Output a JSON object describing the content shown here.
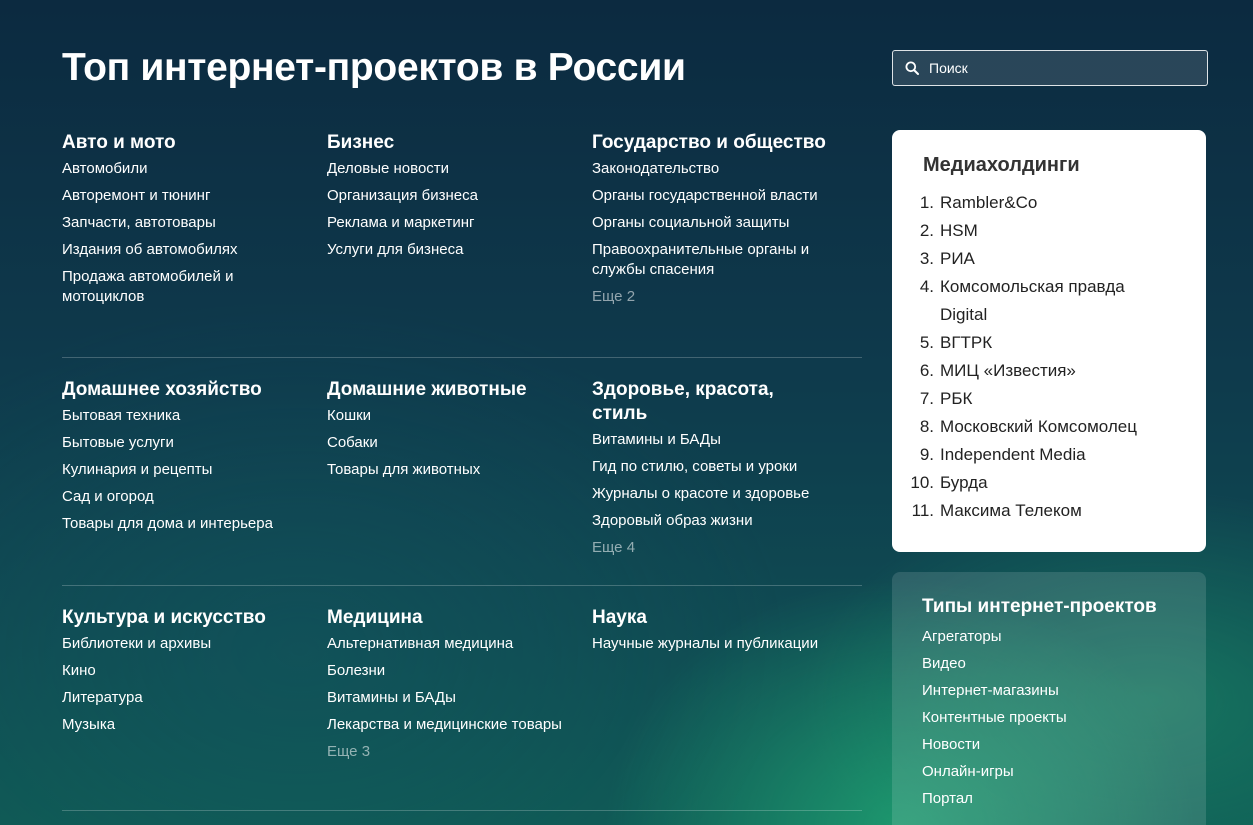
{
  "page_title": "Топ интернет-проектов в России",
  "search": {
    "placeholder": "Поиск"
  },
  "categories": [
    {
      "title": "Авто и мото",
      "links": [
        "Автомобили",
        "Авторемонт и тюнинг",
        "Запчасти, автотовары",
        "Издания об автомобилях",
        "Продажа автомобилей и мотоциклов"
      ],
      "more": ""
    },
    {
      "title": "Бизнес",
      "links": [
        "Деловые новости",
        "Организация бизнеса",
        "Реклама и маркетинг",
        "Услуги для бизнеса"
      ],
      "more": ""
    },
    {
      "title": "Государство и общество",
      "links": [
        "Законодательство",
        "Органы государственной власти",
        "Органы социальной защиты",
        "Правоохранительные органы и службы спасения"
      ],
      "more": "Еще 2"
    },
    {
      "title": "Домашнее хозяйство",
      "links": [
        "Бытовая техника",
        "Бытовые услуги",
        "Кулинария и рецепты",
        "Сад и огород",
        "Товары для дома и интерьера"
      ],
      "more": ""
    },
    {
      "title": "Домашние животные",
      "links": [
        "Кошки",
        "Собаки",
        "Товары для животных"
      ],
      "more": ""
    },
    {
      "title": "Здоровье, красота, стиль",
      "links": [
        "Витамины и БАДы",
        "Гид по стилю, советы и уроки",
        "Журналы о красоте и здоровье",
        "Здоровый образ жизни"
      ],
      "more": "Еще 4"
    },
    {
      "title": "Культура и искусство",
      "links": [
        "Библиотеки и архивы",
        "Кино",
        "Литература",
        "Музыка"
      ],
      "more": ""
    },
    {
      "title": "Медицина",
      "links": [
        "Альтернативная медицина",
        "Болезни",
        "Витамины и БАДы",
        "Лекарства и медицинские товары"
      ],
      "more": "Еще 3"
    },
    {
      "title": "Наука",
      "links": [
        "Научные журналы и публикации"
      ],
      "more": ""
    }
  ],
  "media": {
    "title": "Медиахолдинги",
    "items": [
      {
        "num": "1.",
        "name": "Rambler&Co"
      },
      {
        "num": "2.",
        "name": "HSM"
      },
      {
        "num": "3.",
        "name": "РИА"
      },
      {
        "num": "4.",
        "name": "Комсомольская правда Digital"
      },
      {
        "num": "5.",
        "name": "ВГТРК"
      },
      {
        "num": "6.",
        "name": "МИЦ «Известия»"
      },
      {
        "num": "7.",
        "name": "РБК"
      },
      {
        "num": "8.",
        "name": "Московский Комсомолец"
      },
      {
        "num": "9.",
        "name": "Independent Media"
      },
      {
        "num": "10.",
        "name": "Бурда"
      },
      {
        "num": "11.",
        "name": "Максима Телеком"
      }
    ]
  },
  "types": {
    "title": "Типы интернет-проектов",
    "links": [
      "Агрегаторы",
      "Видео",
      "Интернет-магазины",
      "Контентные проекты",
      "Новости",
      "Онлайн-игры",
      "Портал"
    ]
  },
  "colors": {
    "card_bg": "#ffffff",
    "bg_dark": "#0c2a40",
    "bg_green": "#1fb580"
  },
  "icons": {
    "search": "search-icon"
  }
}
